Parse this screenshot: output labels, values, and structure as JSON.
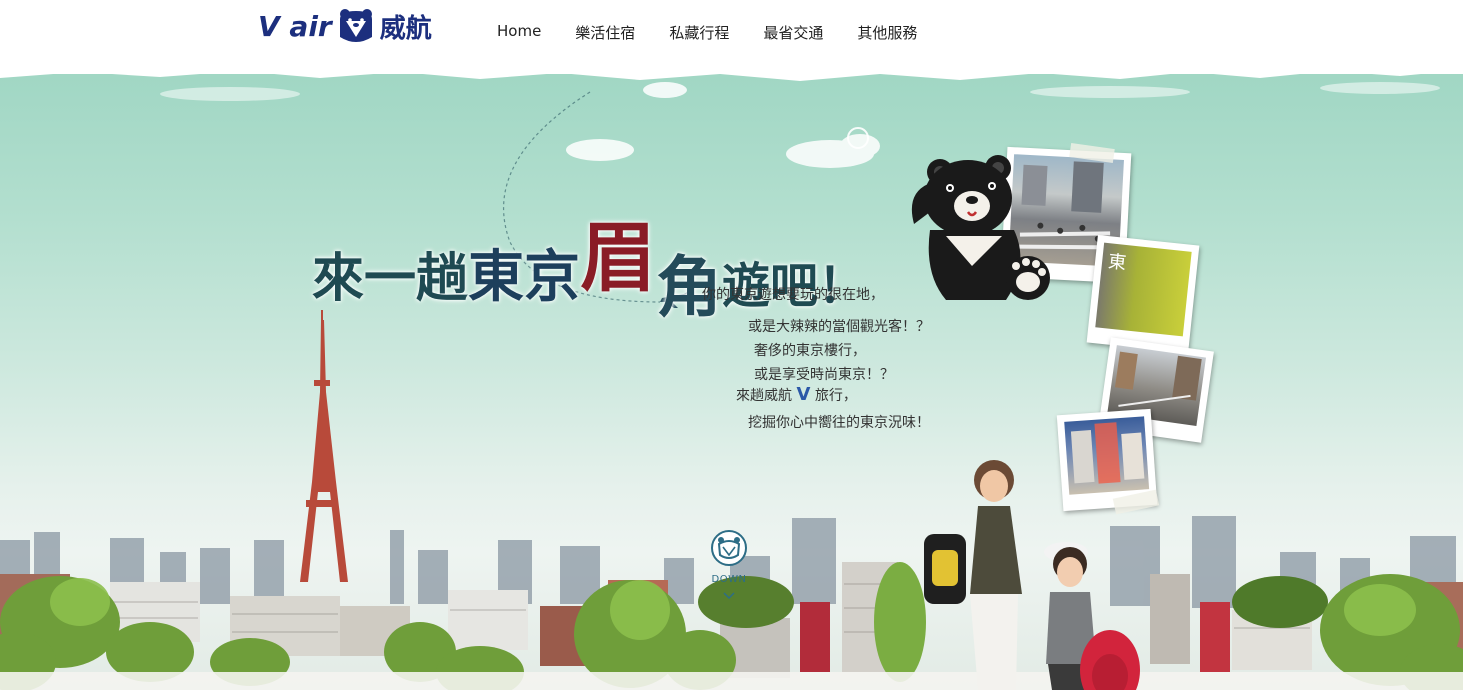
{
  "logo": {
    "brand": "V air",
    "chinese": "威航"
  },
  "nav": {
    "items": [
      {
        "label": "Home"
      },
      {
        "label": "樂活住宿"
      },
      {
        "label": "私藏行程"
      },
      {
        "label": "最省交通"
      },
      {
        "label": "其他服務"
      }
    ]
  },
  "hero": {
    "headline": {
      "part1": "來一趟",
      "part2": "東京",
      "part3": "眉",
      "part4": "角",
      "part5": "遊吧！"
    },
    "copy": {
      "line1": "你的東京遊想要玩的很在地，",
      "line2": "或是大辣辣的當個觀光客！？",
      "line3": "奢侈的東京樓行，",
      "line4": "或是享受時尚東京！？",
      "line5_before": "來趟威航",
      "line5_v": "V",
      "line5_after": "旅行，",
      "line6": "挖掘你心中嚮往的東京況味！"
    },
    "down_label": "DOWN",
    "photo_text": "東"
  },
  "colors": {
    "brand": "#1c2f7e",
    "sky_top": "#9fd6c3",
    "headline_red": "#8a1c26"
  }
}
